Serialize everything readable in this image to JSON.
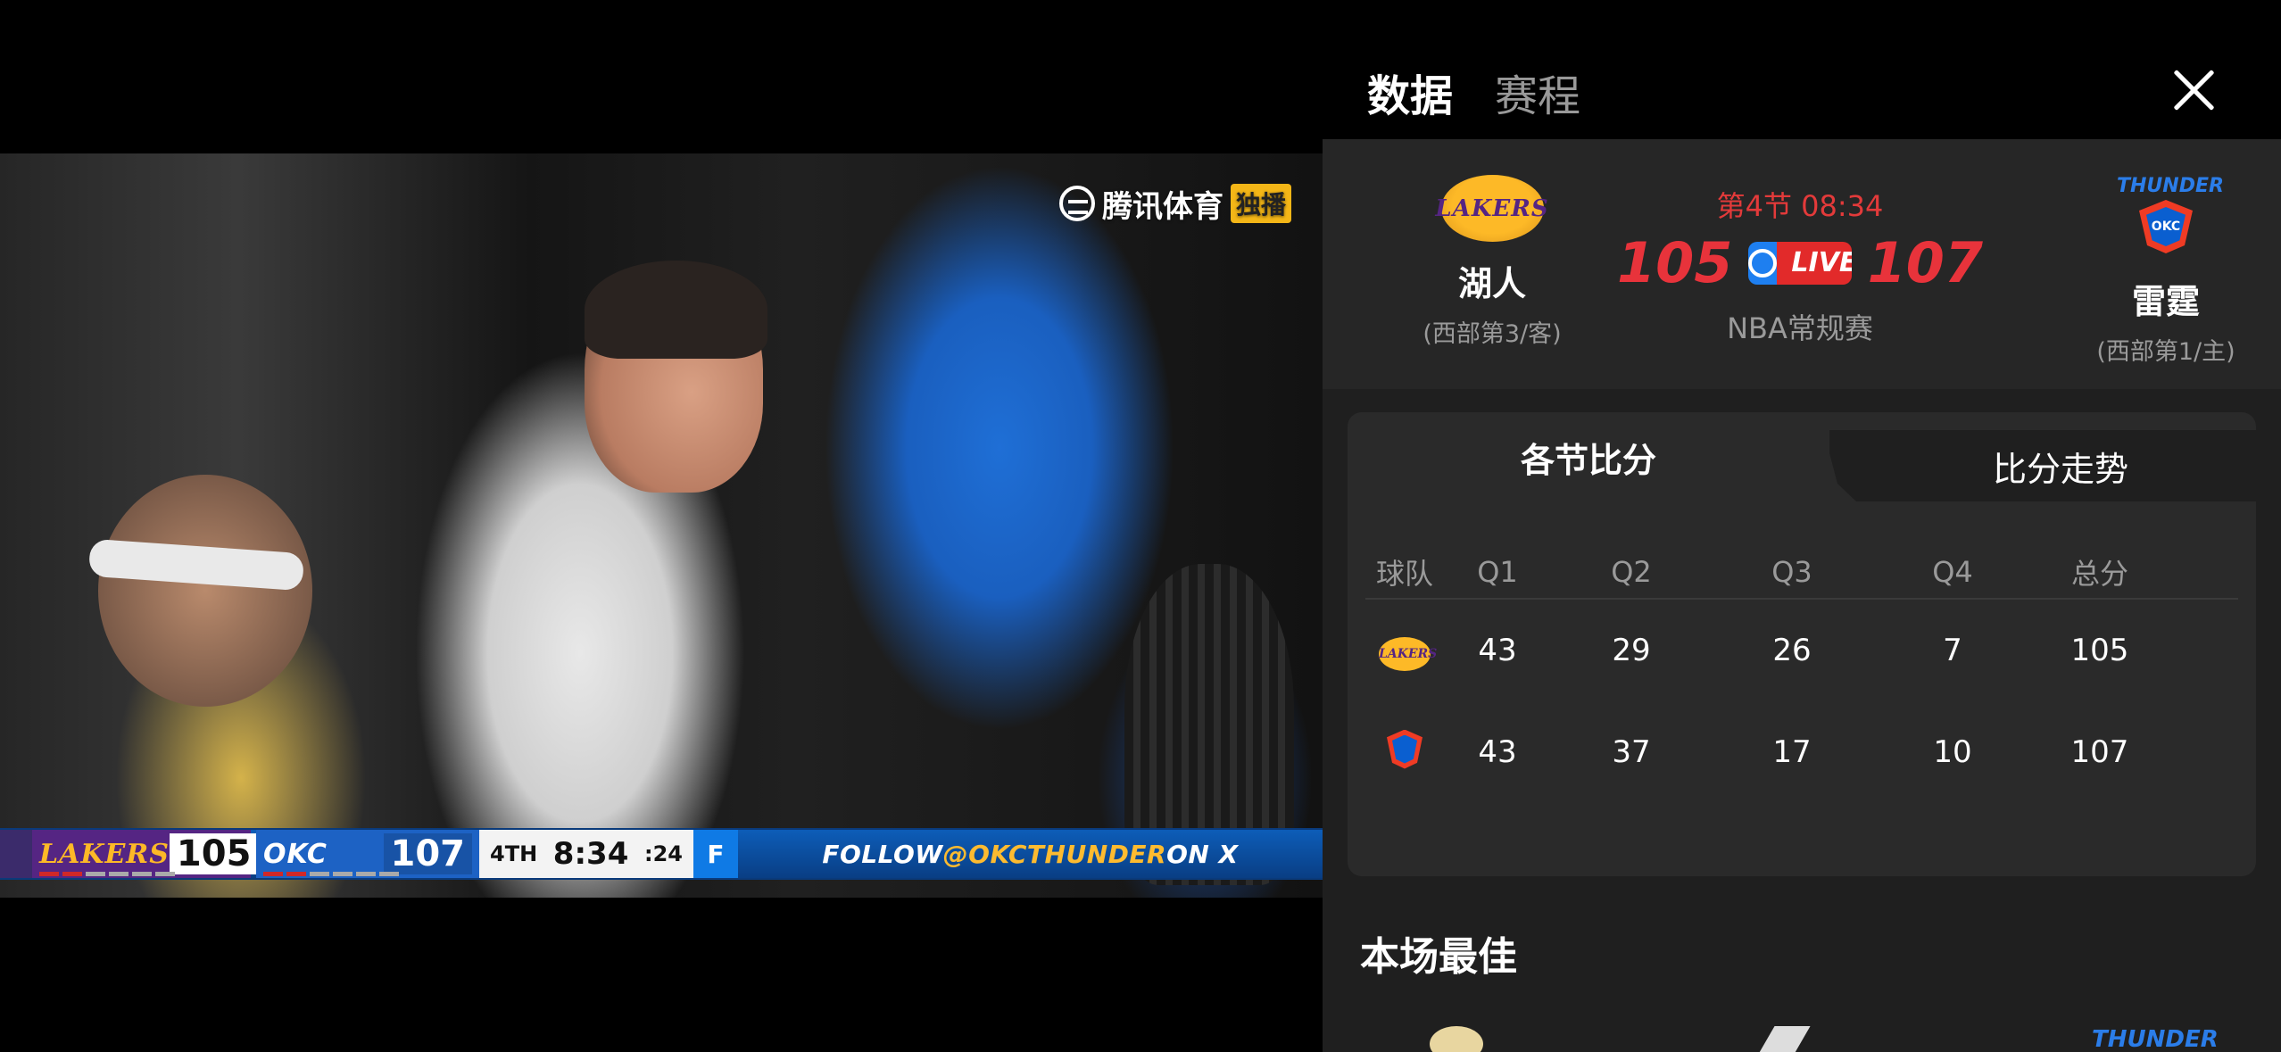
{
  "video": {
    "watermark": {
      "brand": "腾讯体育",
      "badge": "独播"
    },
    "scorebug": {
      "home_team": "LAKERS",
      "home_score": "105",
      "away_team": "OKC",
      "away_score": "107",
      "period": "4TH",
      "clock": "8:34",
      "shot_clock": ":24",
      "sponsor_icon": "fanduel-icon",
      "follow_prefix": "FOLLOW ",
      "follow_handle": "@OKCTHUNDER",
      "follow_suffix": " ON X"
    }
  },
  "panel": {
    "tabs": {
      "data": "数据",
      "schedule": "赛程"
    },
    "match": {
      "home": {
        "name": "湖人",
        "rank": "(西部第3/客)",
        "logo_text": "LAKERS"
      },
      "away": {
        "name": "雷霆",
        "rank": "(西部第1/主)",
        "logo_text": "THUNDER",
        "logo_sub": "OKC"
      },
      "status": "第4节 08:34",
      "home_score": "105",
      "away_score": "107",
      "live_label": "LIVE",
      "league": "NBA常规赛"
    },
    "boxscore": {
      "tab_active": "各节比分",
      "tab_inactive": "比分走势",
      "headers": [
        "球队",
        "Q1",
        "Q2",
        "Q3",
        "Q4",
        "总分"
      ],
      "rows": [
        {
          "team": "lakers",
          "q1": "43",
          "q2": "29",
          "q3": "26",
          "q4": "7",
          "total": "105"
        },
        {
          "team": "thunder",
          "q1": "43",
          "q2": "37",
          "q3": "17",
          "q4": "10",
          "total": "107"
        }
      ]
    },
    "best": {
      "title": "本场最佳",
      "peek_text": "THUNDER"
    }
  },
  "colors": {
    "accent_red": "#e8333b",
    "live_blue": "#1e7ff0",
    "lakers_gold": "#fdb927",
    "lakers_purple": "#552583",
    "thunder_blue": "#0a5fd0"
  }
}
